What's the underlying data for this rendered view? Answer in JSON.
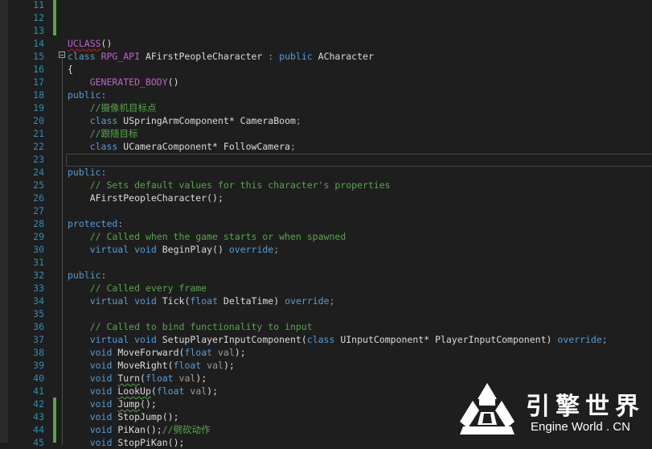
{
  "editor": {
    "line_numbers": [
      "11",
      "12",
      "13",
      "14",
      "15",
      "16",
      "17",
      "18",
      "19",
      "20",
      "21",
      "22",
      "23",
      "24",
      "25",
      "26",
      "27",
      "28",
      "29",
      "30",
      "31",
      "32",
      "33",
      "34",
      "35",
      "36",
      "37",
      "38",
      "39",
      "40",
      "41",
      "42",
      "43",
      "44",
      "45"
    ],
    "code": {
      "l14": {
        "a": "UCLASS",
        "b": "()"
      },
      "l15": {
        "a": "class",
        "b": " ",
        "c": "RPG_API",
        "d": " AFirstPeopleCharacter ",
        "e": ":",
        "f": " ",
        "g": "public",
        "h": " ",
        "i": "ACharacter"
      },
      "l16": {
        "a": "{"
      },
      "l17": {
        "a": "GENERATED_BODY",
        "b": "()"
      },
      "l18": {
        "a": "public",
        "b": ":"
      },
      "l19": {
        "a": "//摄像机目标点"
      },
      "l20": {
        "a": "class",
        "b": " ",
        "c": "USpringArmComponent",
        "d": "* CameraBoom",
        "e": ";"
      },
      "l21": {
        "a": "//跟随目标"
      },
      "l22": {
        "a": "class",
        "b": " ",
        "c": "UCameraComponent",
        "d": "* FollowCamera",
        "e": ";"
      },
      "l24": {
        "a": "public",
        "b": ":"
      },
      "l25": {
        "a": "// Sets default values for this character's properties"
      },
      "l26": {
        "a": "AFirstPeopleCharacter",
        "b": "();"
      },
      "l28": {
        "a": "protected",
        "b": ":"
      },
      "l29": {
        "a": "// Called when the game starts or when spawned"
      },
      "l30": {
        "a": "virtual",
        "b": " ",
        "c": "void",
        "d": " BeginPlay",
        "e": "()",
        "f": " ",
        "g": "override",
        "h": ";"
      },
      "l32": {
        "a": "public",
        "b": ":"
      },
      "l33": {
        "a": "// Called every frame"
      },
      "l34": {
        "a": "virtual",
        "b": " ",
        "c": "void",
        "d": " Tick",
        "e": "(",
        "f": "float",
        "g": " DeltaTime",
        "h": ")",
        "i": " ",
        "j": "override",
        "k": ";"
      },
      "l36": {
        "a": "// Called to bind functionality to input"
      },
      "l37": {
        "a": "virtual",
        "b": " ",
        "c": "void",
        "d": " SetupPlayerInputComponent",
        "e": "(",
        "f": "class",
        "g": " ",
        "h": "UInputComponent",
        "i": "* PlayerInputComponent",
        "j": ")",
        "k": " ",
        "l": "override",
        "m": ";"
      },
      "l38": {
        "a": "void",
        "b": " MoveForward",
        "c": "(",
        "d": "float",
        "e": " ",
        "f": "val",
        "g": ");"
      },
      "l39": {
        "a": "void",
        "b": " MoveRight",
        "c": "(",
        "d": "float",
        "e": " ",
        "f": "val",
        "g": ");"
      },
      "l40": {
        "a": "void",
        "b": " ",
        "c": "Turn",
        "d": "(",
        "e": "float",
        "f": " ",
        "g": "val",
        "h": ");"
      },
      "l41": {
        "a": "void",
        "b": " ",
        "c": "LookUp",
        "d": "(",
        "e": "float",
        "f": " ",
        "g": "val",
        "h": ");"
      },
      "l42": {
        "a": "void",
        "b": " ",
        "c": "Jump",
        "d": "();"
      },
      "l43": {
        "a": "void",
        "b": " StopJump",
        "c": "();"
      },
      "l44": {
        "a": "void",
        "b": " PiKan",
        "c": "();",
        "d": "//劈砍动作"
      },
      "l45": {
        "a": "void",
        "b": " StopPiKan",
        "c": "();"
      }
    }
  },
  "watermark": {
    "chinese": "引擎世界",
    "english": "Engine World . CN",
    "icon": "engine-world-logo"
  },
  "colors": {
    "background": "#1e1e1e",
    "line_number": "#2b91af",
    "keyword": "#569cd6",
    "macro": "#bd63c5",
    "comment": "#57a64a",
    "type": "#4ec9b0",
    "change_bar": "#57a64a"
  }
}
